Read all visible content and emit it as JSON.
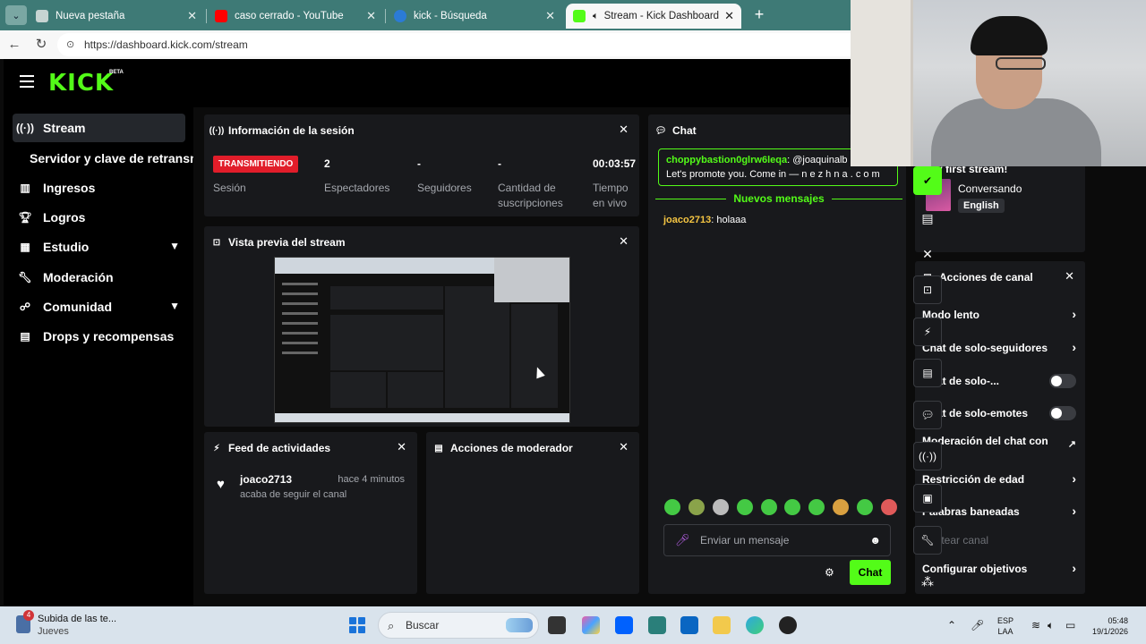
{
  "browser": {
    "tabs": [
      {
        "title": "Nueva pestaña",
        "active": false
      },
      {
        "title": "caso cerrado - YouTube",
        "active": false
      },
      {
        "title": "kick - Búsqueda",
        "active": false
      },
      {
        "title": "Stream - Kick Dashboard",
        "active": true
      }
    ],
    "url": "https://dashboard.kick.com/stream"
  },
  "kick": {
    "logo": "KICK",
    "logo_badge": "BETA"
  },
  "sidebar": {
    "items": [
      {
        "label": "Stream",
        "icon": "broadcast-icon",
        "active": true
      },
      {
        "label": "Servidor y clave de retransmisión",
        "sub": true
      },
      {
        "label": "Ingresos",
        "icon": "chart-icon"
      },
      {
        "label": "Logros",
        "icon": "trophy-icon"
      },
      {
        "label": "Estudio",
        "icon": "studio-icon",
        "expandable": true
      },
      {
        "label": "Moderación",
        "icon": "wrench-icon"
      },
      {
        "label": "Comunidad",
        "icon": "community-icon",
        "expandable": true
      },
      {
        "label": "Drops y recompensas",
        "icon": "gift-icon"
      }
    ]
  },
  "session": {
    "title": "Información de la sesión",
    "live_badge": "TRANSMITIENDO",
    "session_label": "Sesión",
    "stats": [
      {
        "value": "2",
        "label": "Espectadores"
      },
      {
        "value": "-",
        "label": "Seguidores"
      },
      {
        "value": "-",
        "label": "Cantidad de suscripciones"
      },
      {
        "value": "00:03:57",
        "label": "Tiempo en vivo"
      }
    ]
  },
  "preview": {
    "title": "Vista previa del stream"
  },
  "activity": {
    "title": "Feed de actividades",
    "items": [
      {
        "user": "joaco2713",
        "time": "hace 4 minutos",
        "desc": "acaba de seguir el canal"
      }
    ]
  },
  "mod_actions": {
    "title": "Acciones de moderador"
  },
  "chat": {
    "title": "Chat",
    "pinned_user": "choppybastion0glrw6leqa",
    "pinned_text": ": @joaquinalb",
    "pinned_text2": "Let's promote you. Come in — n e z h n a . c o m",
    "new_messages": "Nuevos mensajes",
    "messages": [
      {
        "user": "joaco2713",
        "text": "holaaa"
      }
    ],
    "input_placeholder": "Enviar un mensaje",
    "send_label": "Chat"
  },
  "stream_info": {
    "title": "My first stream!",
    "category": "Conversando",
    "language": "English"
  },
  "channel_actions": {
    "title": "Acciones de canal",
    "items": [
      {
        "label": "Modo lento",
        "control": "chevron"
      },
      {
        "label": "Chat de solo-seguidores",
        "control": "chevron"
      },
      {
        "label": "Chat de solo-...",
        "control": "toggle",
        "on": false
      },
      {
        "label": "Chat de solo-emotes",
        "control": "toggle",
        "on": false
      },
      {
        "label": "Moderación del chat con IA",
        "control": "external"
      },
      {
        "label": "Restricción de edad",
        "control": "chevron"
      },
      {
        "label": "Palabras baneadas",
        "control": "chevron"
      },
      {
        "label": "Hostear canal",
        "control": "none",
        "disabled": true
      },
      {
        "label": "Configurar objetivos",
        "control": "chevron"
      }
    ]
  },
  "taskbar": {
    "notification_title": "Subida de las te...",
    "notification_sub": "Jueves",
    "notification_count": "4",
    "search_placeholder": "Buscar",
    "lang_top": "ESP",
    "lang_bottom": "LAA",
    "time": "05:48",
    "date": "19/1/2026"
  }
}
